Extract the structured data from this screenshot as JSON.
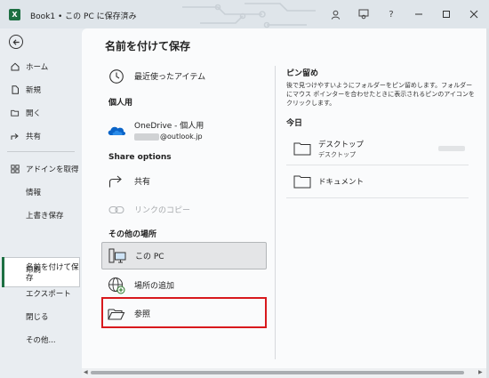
{
  "titlebar": {
    "title": "Book1 • この PC に保存済み",
    "help": "?"
  },
  "nav": {
    "home": "ホーム",
    "new": "新規",
    "open": "開く",
    "share": "共有",
    "addins": "アドインを取得",
    "info": "情報",
    "overwrite": "上書き保存",
    "save_as": "名前を付けて保存",
    "print": "印刷",
    "export": "エクスポート",
    "close": "閉じる",
    "more": "その他..."
  },
  "main": {
    "title": "名前を付けて保存",
    "recent": "最近使ったアイテム",
    "personal_header": "個人用",
    "onedrive_label": "OneDrive - 個人用",
    "onedrive_email": "@outlook.jp",
    "share_options_header": "Share options",
    "share": "共有",
    "copy_link": "リンクのコピー",
    "other_header": "その他の場所",
    "this_pc": "この PC",
    "add_place": "場所の追加",
    "browse": "参照"
  },
  "right": {
    "pinned_title": "ピン留め",
    "pinned_desc": "後で見つけやすいようにフォルダーをピン留めします。フォルダーにマウス ポインターを合わせたときに表示されるピンのアイコンをクリックします。",
    "today_title": "今日",
    "folders": [
      {
        "name": "デスクトップ",
        "sub": "デスクトップ"
      },
      {
        "name": "ドキュメント",
        "sub": ""
      }
    ]
  }
}
